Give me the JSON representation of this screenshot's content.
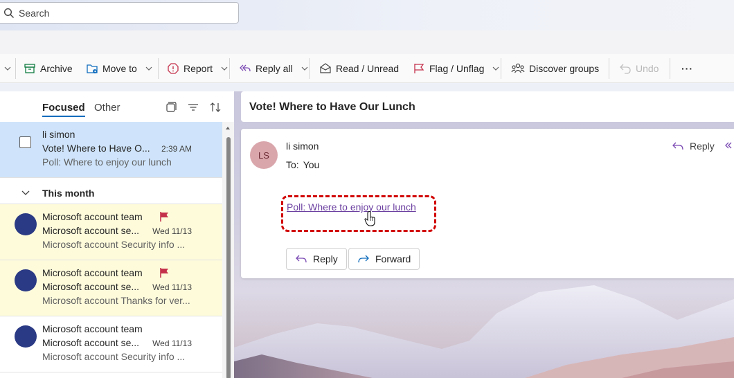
{
  "search": {
    "placeholder": "Search"
  },
  "ribbon": {
    "archive": "Archive",
    "move_to": "Move to",
    "report": "Report",
    "reply_all": "Reply all",
    "read_unread": "Read / Unread",
    "flag_unflag": "Flag / Unflag",
    "discover_groups": "Discover groups",
    "undo": "Undo",
    "more": "···"
  },
  "list": {
    "tabs": {
      "focused": "Focused",
      "other": "Other"
    },
    "selected_message": {
      "sender": "li simon",
      "subject": "Vote! Where to Have O...",
      "time": "2:39 AM",
      "preview": "Poll: Where to enjoy our lunch"
    },
    "group_label": "This month",
    "messages": [
      {
        "sender": "Microsoft account team",
        "subject": "Microsoft account se...",
        "date": "Wed 11/13",
        "preview": "Microsoft account Security info ...",
        "flagged": true,
        "highlight": true
      },
      {
        "sender": "Microsoft account team",
        "subject": "Microsoft account se...",
        "date": "Wed 11/13",
        "preview": "Microsoft account Thanks for ver...",
        "flagged": true,
        "highlight": true
      },
      {
        "sender": "Microsoft account team",
        "subject": "Microsoft account se...",
        "date": "Wed 11/13",
        "preview": "Microsoft account Security info ...",
        "flagged": false,
        "highlight": false
      }
    ]
  },
  "reading": {
    "subject": "Vote! Where to Have Our Lunch",
    "avatar_initials": "LS",
    "sender": "li simon",
    "to_label": "To:",
    "to_value": "You",
    "header_reply": "Reply",
    "poll_link": "Poll: Where to enjoy our lunch",
    "reply_button": "Reply",
    "forward_button": "Forward"
  },
  "colors": {
    "accent": "#0f6cbd",
    "selected_row": "#cfe4fa",
    "flagged_row": "#fefbdb",
    "flag": "#c4314b",
    "avatar_ms": "#2b3a84",
    "avatar_ls": "#d9a6ac",
    "highlight_box": "#d10000",
    "link": "#6b3fa0"
  }
}
